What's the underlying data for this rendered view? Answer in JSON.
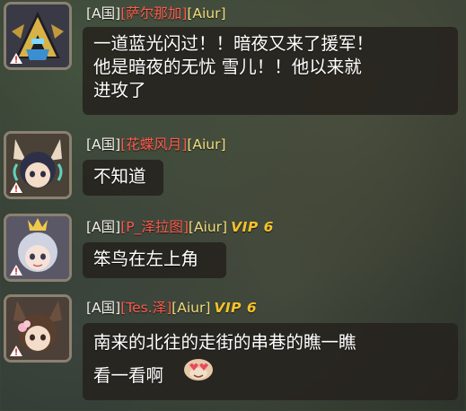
{
  "messages": [
    {
      "country": "[A国]",
      "name": "[萨尔那加]",
      "guild": "[Aiur]",
      "vip": "",
      "lines": [
        "一道蓝光闪过！！暗夜又来了援军！",
        "他是暗夜的无忧 雪儿！！他以来就",
        "进攻了"
      ],
      "avatar": "helmet-warrior-avatar"
    },
    {
      "country": "[A国]",
      "name": "[花蝶风月]",
      "guild": "[Aiur]",
      "vip": "",
      "lines": [
        "不知道"
      ],
      "avatar": "fox-girl-avatar"
    },
    {
      "country": "[A国]",
      "name": "[P_泽拉图]",
      "guild": "[Aiur]",
      "vip": "VIP 6",
      "lines": [
        "笨鸟在左上角"
      ],
      "avatar": "crowned-girl-avatar"
    },
    {
      "country": "[A国]",
      "name": "[Tes.泽]",
      "guild": "[Aiur]",
      "vip": "VIP 6",
      "lines": [
        "南来的北往的走街的串巷的瞧一瞧",
        "看一看啊"
      ],
      "avatar": "flower-girl-avatar"
    }
  ],
  "colors": {
    "name": "#ff5a4d",
    "guild": "#f2dd7a",
    "vip": "#f6c22a",
    "bubble": "#26221e"
  }
}
